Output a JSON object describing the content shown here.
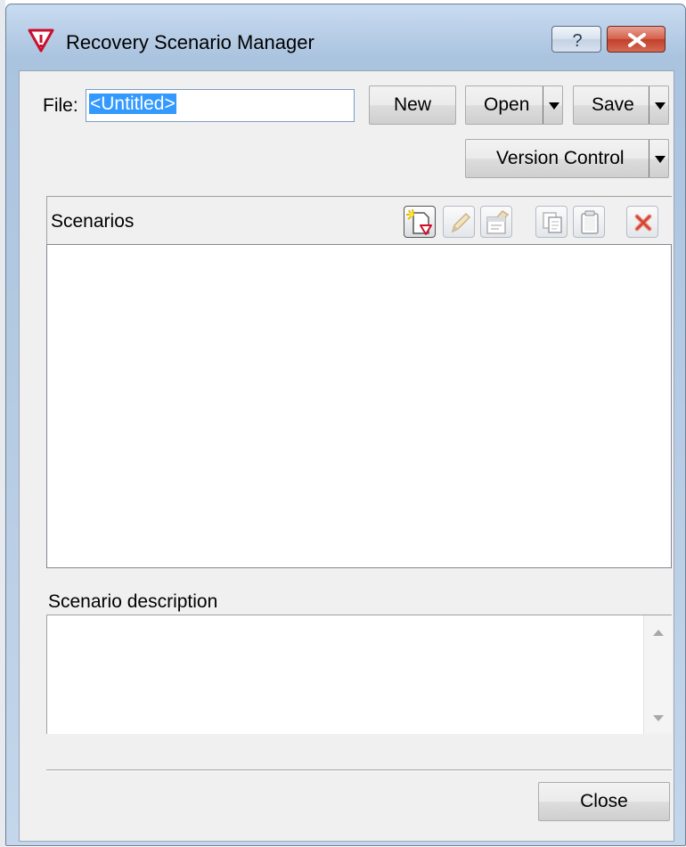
{
  "window": {
    "title": "Recovery Scenario Manager",
    "help_glyph": "?",
    "icons": {
      "app": "warning-triangle-icon",
      "help": "help-icon",
      "close": "close-icon"
    }
  },
  "file": {
    "label": "File:",
    "value": "<Untitled>"
  },
  "buttons": {
    "new": "New",
    "open": "Open",
    "save": "Save",
    "version_control": "Version Control",
    "close": "Close"
  },
  "scenarios": {
    "header": "Scenarios",
    "items": [],
    "toolbar": [
      "new-scenario-icon",
      "edit-icon",
      "properties-icon",
      "copy-icon",
      "paste-icon",
      "delete-icon"
    ]
  },
  "description": {
    "label": "Scenario description",
    "value": ""
  },
  "colors": {
    "selection": "#3399ff",
    "delete_red": "#d6432d",
    "app_icon_red": "#c8102e"
  }
}
